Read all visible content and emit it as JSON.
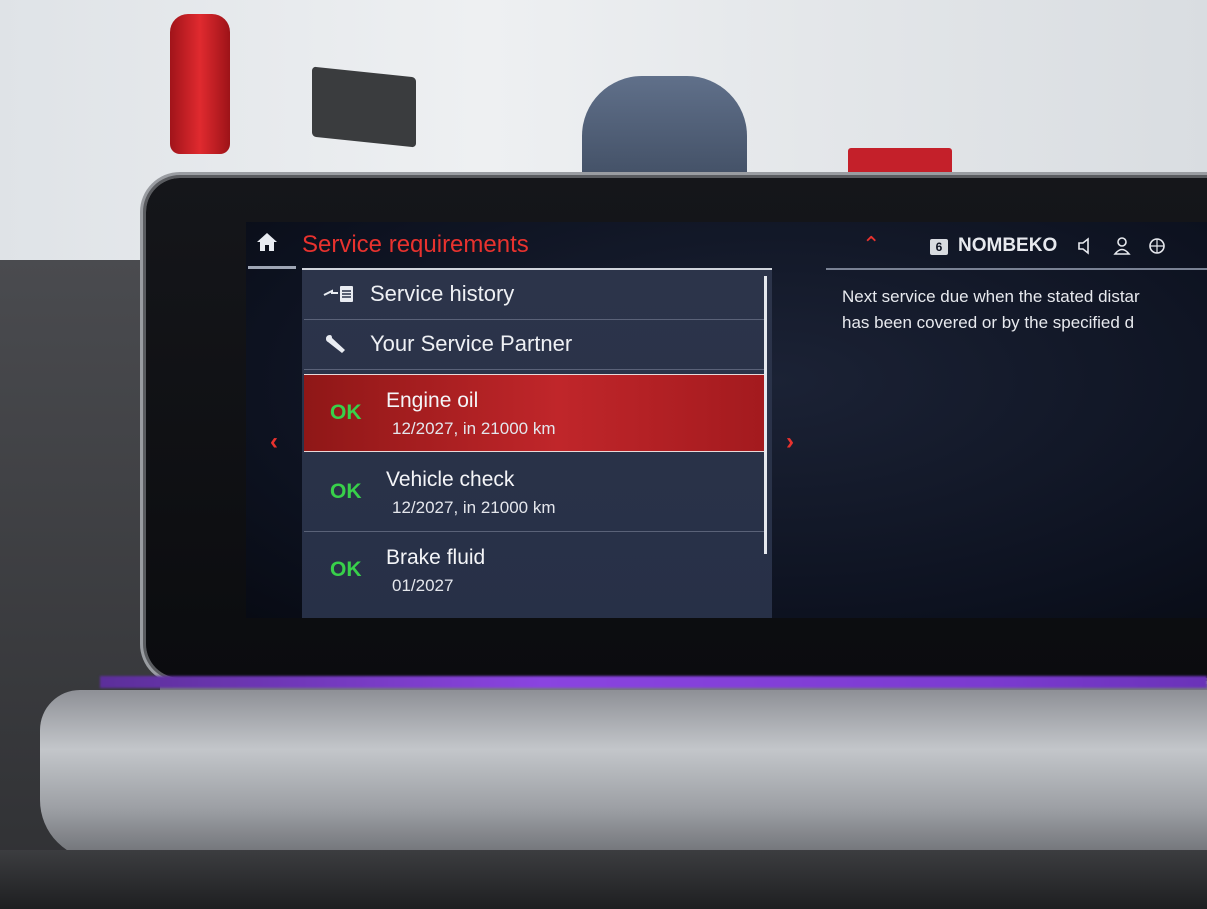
{
  "header": {
    "title": "Service requirements",
    "profile_number": "6",
    "profile_name": "NOMBEKO"
  },
  "menu": {
    "service_history": "Service history",
    "service_partner": "Your Service Partner"
  },
  "services": [
    {
      "status": "OK",
      "name": "Engine oil",
      "due": "12/2027, in 21000 km",
      "selected": true
    },
    {
      "status": "OK",
      "name": "Vehicle check",
      "due": "12/2027, in 21000 km",
      "selected": false
    },
    {
      "status": "OK",
      "name": "Brake fluid",
      "due": "01/2027",
      "selected": false
    }
  ],
  "info": {
    "line1": "Next service due when the stated distar",
    "line2": "has been covered or by the specified d"
  },
  "colors": {
    "accent": "#e8322e",
    "ok": "#38d04a",
    "selected_row": "#c0262a"
  },
  "icons": [
    "home-icon",
    "wrench-icon",
    "service-history-icon",
    "mute-icon",
    "user-icon",
    "connectivity-icon",
    "chevron-left-icon",
    "chevron-right-icon",
    "chevron-up-icon"
  ]
}
